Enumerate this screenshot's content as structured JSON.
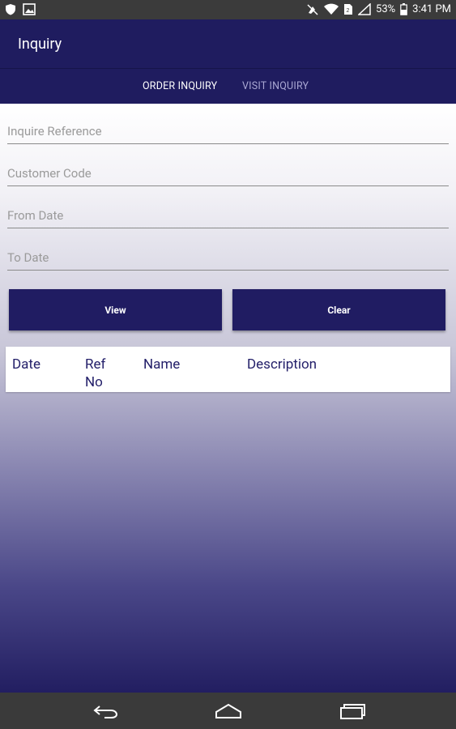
{
  "status_bar": {
    "battery_percent": "53%",
    "time": "3:41 PM",
    "icons": [
      "shield-icon",
      "image-icon",
      "mute-icon",
      "wifi-icon",
      "sim-icon",
      "signal-icon",
      "battery-icon"
    ]
  },
  "app_bar": {
    "title": "Inquiry"
  },
  "tabs": [
    {
      "label": "ORDER INQUIRY",
      "active": true
    },
    {
      "label": "VISIT INQUIRY",
      "active": false
    }
  ],
  "form": {
    "fields": [
      {
        "placeholder": "Inquire Reference",
        "value": ""
      },
      {
        "placeholder": "Customer Code",
        "value": ""
      },
      {
        "placeholder": "From Date",
        "value": ""
      },
      {
        "placeholder": "To Date",
        "value": ""
      }
    ],
    "view_label": "View",
    "clear_label": "Clear"
  },
  "table": {
    "columns": [
      "Date",
      "Ref\nNo",
      "Name",
      "Description"
    ]
  },
  "nav_bar": {
    "icons": [
      "back-icon",
      "home-icon",
      "recents-icon"
    ]
  },
  "colors": {
    "primary": "#1f1c5f",
    "nav_bar": "#3a3a3a",
    "status_bar": "#3b3b3b"
  }
}
